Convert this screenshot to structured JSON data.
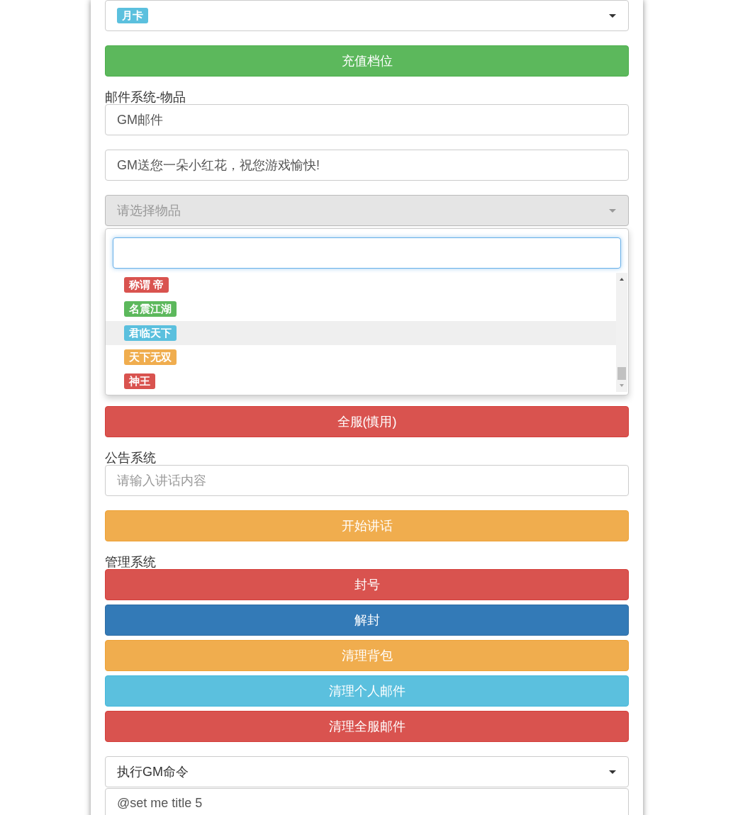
{
  "recharge": {
    "select_tag": {
      "label": "月卡",
      "color": "#5bc0de"
    },
    "button": {
      "label": "充值档位",
      "kind": "success"
    }
  },
  "mail": {
    "label": "邮件系统-物品",
    "title_value": "GM邮件",
    "body_value": "GM送您一朵小红花，祝您游戏愉快!",
    "item_select": {
      "placeholder": "请选择物品",
      "disabled": true,
      "expanded": true
    },
    "options": [
      {
        "label": "称谓 帝",
        "color": "#d9534f",
        "selected": false
      },
      {
        "label": "名震江湖",
        "color": "#5cb85c",
        "selected": false
      },
      {
        "label": "君临天下",
        "color": "#5bc0de",
        "selected": true
      },
      {
        "label": "天下无双",
        "color": "#f0ad4e",
        "selected": false
      },
      {
        "label": "神王",
        "color": "#d9534f",
        "selected": false
      }
    ],
    "send_button": {
      "label": "全服(慎用)",
      "kind": "danger"
    }
  },
  "announcement": {
    "label": "公告系统",
    "placeholder": "请输入讲话内容",
    "button": {
      "label": "开始讲话",
      "kind": "warning"
    }
  },
  "admin": {
    "label": "管理系统",
    "buttons": [
      {
        "label": "封号",
        "kind": "danger"
      },
      {
        "label": "解封",
        "kind": "primary"
      },
      {
        "label": "清理背包",
        "kind": "warning"
      },
      {
        "label": "清理个人邮件",
        "kind": "info"
      },
      {
        "label": "清理全服邮件",
        "kind": "danger"
      }
    ]
  },
  "gm_command": {
    "select_value": "执行GM命令",
    "command_value": "@set me title 5"
  }
}
